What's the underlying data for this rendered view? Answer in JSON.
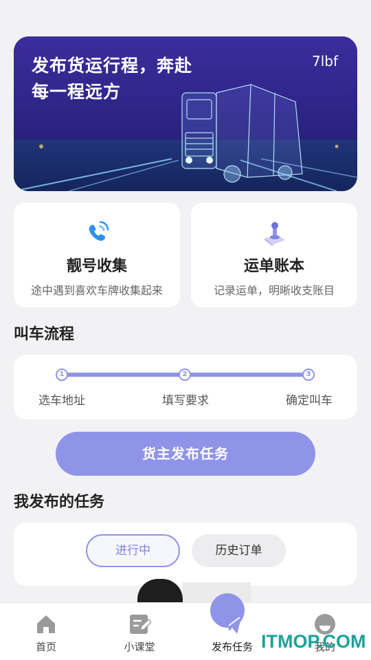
{
  "banner": {
    "title": "发布货运行程，奔赴\n每一程远方",
    "tag": "7lbf"
  },
  "cards": [
    {
      "icon": "phone-icon",
      "title": "靓号收集",
      "subtitle": "途中遇到喜欢车牌收集起来"
    },
    {
      "icon": "stamp-icon",
      "title": "运单账本",
      "subtitle": "记录运单，明晰收支账目"
    }
  ],
  "process": {
    "title": "叫车流程",
    "steps": [
      {
        "num": "1",
        "label": "选车地址"
      },
      {
        "num": "2",
        "label": "填写要求"
      },
      {
        "num": "3",
        "label": "确定叫车"
      }
    ]
  },
  "publish_button": "货主发布任务",
  "tasks": {
    "title": "我发布的任务",
    "tabs": [
      "进行中",
      "历史订单"
    ],
    "active_tab": "进行中"
  },
  "nav": [
    {
      "icon": "home-icon",
      "label": "首页"
    },
    {
      "icon": "notebook-icon",
      "label": "小课堂"
    },
    {
      "icon": "send-icon",
      "label": "发布任务",
      "active": true
    },
    {
      "icon": "profile-icon",
      "label": "我的"
    }
  ],
  "watermark": "ITMOP.COM",
  "colors": {
    "accent": "#8f94e8",
    "background": "#f2f2f4"
  }
}
